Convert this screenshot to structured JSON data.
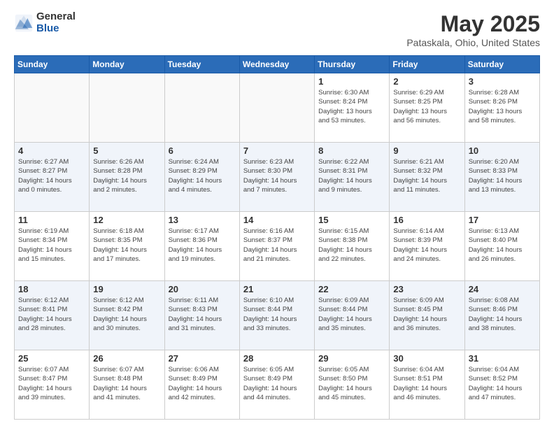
{
  "logo": {
    "general": "General",
    "blue": "Blue"
  },
  "title": {
    "month": "May 2025",
    "location": "Pataskala, Ohio, United States"
  },
  "weekdays": [
    "Sunday",
    "Monday",
    "Tuesday",
    "Wednesday",
    "Thursday",
    "Friday",
    "Saturday"
  ],
  "weeks": [
    [
      {
        "day": "",
        "info": ""
      },
      {
        "day": "",
        "info": ""
      },
      {
        "day": "",
        "info": ""
      },
      {
        "day": "",
        "info": ""
      },
      {
        "day": "1",
        "info": "Sunrise: 6:30 AM\nSunset: 8:24 PM\nDaylight: 13 hours\nand 53 minutes."
      },
      {
        "day": "2",
        "info": "Sunrise: 6:29 AM\nSunset: 8:25 PM\nDaylight: 13 hours\nand 56 minutes."
      },
      {
        "day": "3",
        "info": "Sunrise: 6:28 AM\nSunset: 8:26 PM\nDaylight: 13 hours\nand 58 minutes."
      }
    ],
    [
      {
        "day": "4",
        "info": "Sunrise: 6:27 AM\nSunset: 8:27 PM\nDaylight: 14 hours\nand 0 minutes."
      },
      {
        "day": "5",
        "info": "Sunrise: 6:26 AM\nSunset: 8:28 PM\nDaylight: 14 hours\nand 2 minutes."
      },
      {
        "day": "6",
        "info": "Sunrise: 6:24 AM\nSunset: 8:29 PM\nDaylight: 14 hours\nand 4 minutes."
      },
      {
        "day": "7",
        "info": "Sunrise: 6:23 AM\nSunset: 8:30 PM\nDaylight: 14 hours\nand 7 minutes."
      },
      {
        "day": "8",
        "info": "Sunrise: 6:22 AM\nSunset: 8:31 PM\nDaylight: 14 hours\nand 9 minutes."
      },
      {
        "day": "9",
        "info": "Sunrise: 6:21 AM\nSunset: 8:32 PM\nDaylight: 14 hours\nand 11 minutes."
      },
      {
        "day": "10",
        "info": "Sunrise: 6:20 AM\nSunset: 8:33 PM\nDaylight: 14 hours\nand 13 minutes."
      }
    ],
    [
      {
        "day": "11",
        "info": "Sunrise: 6:19 AM\nSunset: 8:34 PM\nDaylight: 14 hours\nand 15 minutes."
      },
      {
        "day": "12",
        "info": "Sunrise: 6:18 AM\nSunset: 8:35 PM\nDaylight: 14 hours\nand 17 minutes."
      },
      {
        "day": "13",
        "info": "Sunrise: 6:17 AM\nSunset: 8:36 PM\nDaylight: 14 hours\nand 19 minutes."
      },
      {
        "day": "14",
        "info": "Sunrise: 6:16 AM\nSunset: 8:37 PM\nDaylight: 14 hours\nand 21 minutes."
      },
      {
        "day": "15",
        "info": "Sunrise: 6:15 AM\nSunset: 8:38 PM\nDaylight: 14 hours\nand 22 minutes."
      },
      {
        "day": "16",
        "info": "Sunrise: 6:14 AM\nSunset: 8:39 PM\nDaylight: 14 hours\nand 24 minutes."
      },
      {
        "day": "17",
        "info": "Sunrise: 6:13 AM\nSunset: 8:40 PM\nDaylight: 14 hours\nand 26 minutes."
      }
    ],
    [
      {
        "day": "18",
        "info": "Sunrise: 6:12 AM\nSunset: 8:41 PM\nDaylight: 14 hours\nand 28 minutes."
      },
      {
        "day": "19",
        "info": "Sunrise: 6:12 AM\nSunset: 8:42 PM\nDaylight: 14 hours\nand 30 minutes."
      },
      {
        "day": "20",
        "info": "Sunrise: 6:11 AM\nSunset: 8:43 PM\nDaylight: 14 hours\nand 31 minutes."
      },
      {
        "day": "21",
        "info": "Sunrise: 6:10 AM\nSunset: 8:44 PM\nDaylight: 14 hours\nand 33 minutes."
      },
      {
        "day": "22",
        "info": "Sunrise: 6:09 AM\nSunset: 8:44 PM\nDaylight: 14 hours\nand 35 minutes."
      },
      {
        "day": "23",
        "info": "Sunrise: 6:09 AM\nSunset: 8:45 PM\nDaylight: 14 hours\nand 36 minutes."
      },
      {
        "day": "24",
        "info": "Sunrise: 6:08 AM\nSunset: 8:46 PM\nDaylight: 14 hours\nand 38 minutes."
      }
    ],
    [
      {
        "day": "25",
        "info": "Sunrise: 6:07 AM\nSunset: 8:47 PM\nDaylight: 14 hours\nand 39 minutes."
      },
      {
        "day": "26",
        "info": "Sunrise: 6:07 AM\nSunset: 8:48 PM\nDaylight: 14 hours\nand 41 minutes."
      },
      {
        "day": "27",
        "info": "Sunrise: 6:06 AM\nSunset: 8:49 PM\nDaylight: 14 hours\nand 42 minutes."
      },
      {
        "day": "28",
        "info": "Sunrise: 6:05 AM\nSunset: 8:49 PM\nDaylight: 14 hours\nand 44 minutes."
      },
      {
        "day": "29",
        "info": "Sunrise: 6:05 AM\nSunset: 8:50 PM\nDaylight: 14 hours\nand 45 minutes."
      },
      {
        "day": "30",
        "info": "Sunrise: 6:04 AM\nSunset: 8:51 PM\nDaylight: 14 hours\nand 46 minutes."
      },
      {
        "day": "31",
        "info": "Sunrise: 6:04 AM\nSunset: 8:52 PM\nDaylight: 14 hours\nand 47 minutes."
      }
    ]
  ]
}
